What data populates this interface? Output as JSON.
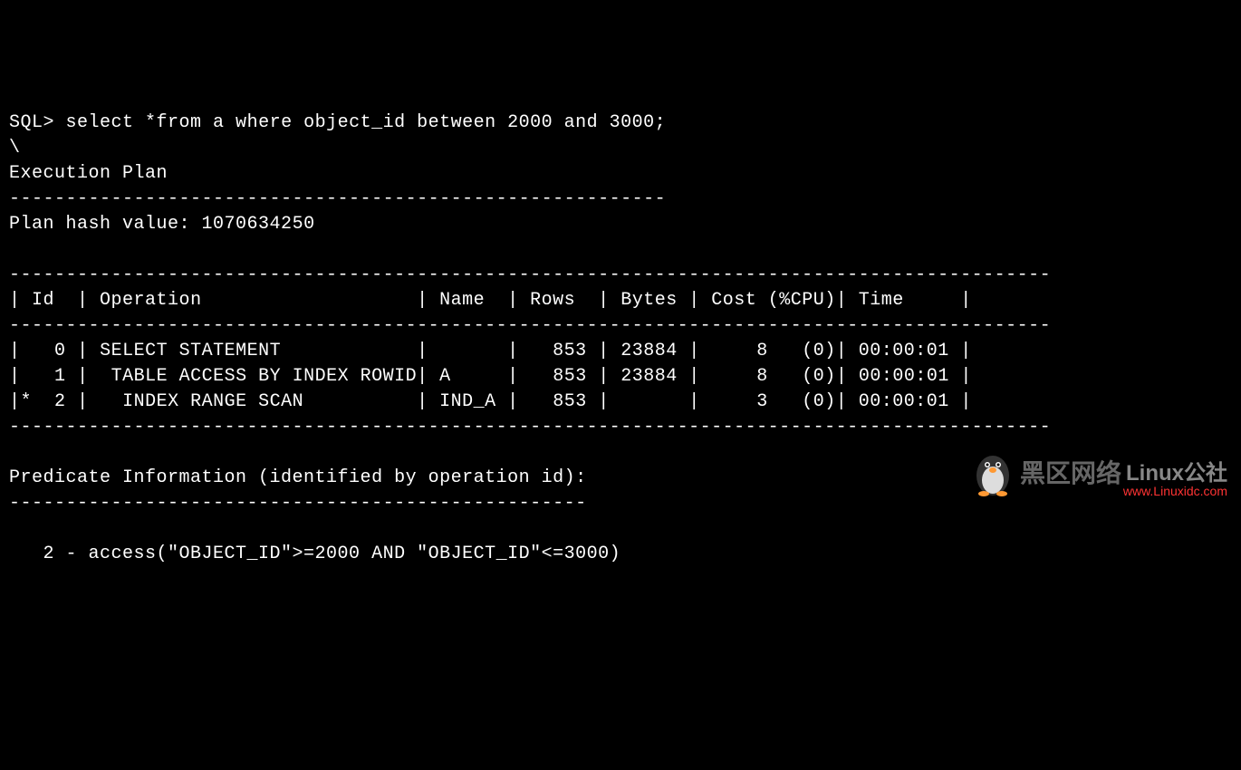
{
  "prompt": "SQL>",
  "query": "select *from a where object_id between 2000 and 3000;",
  "continuation": "\\",
  "section_execution": "Execution Plan",
  "divider_short": "----------------------------------------------------------",
  "plan_hash_label": "Plan hash value:",
  "plan_hash_value": "1070634250",
  "divider_long": "--------------------------------------------------------------------------------------------",
  "table_header": {
    "id": "Id",
    "operation": "Operation",
    "name": "Name",
    "rows": "Rows",
    "bytes": "Bytes",
    "cost": "Cost (%CPU)",
    "time": "Time"
  },
  "plan_rows": [
    {
      "marker": " ",
      "id": "0",
      "operation": "SELECT STATEMENT",
      "name": "",
      "rows": "853",
      "bytes": "23884",
      "cost": "8",
      "cpu": "(0)",
      "time": "00:00:01"
    },
    {
      "marker": " ",
      "id": "1",
      "operation": " TABLE ACCESS BY INDEX ROWID",
      "name": "A",
      "rows": "853",
      "bytes": "23884",
      "cost": "8",
      "cpu": "(0)",
      "time": "00:00:01"
    },
    {
      "marker": "*",
      "id": "2",
      "operation": "  INDEX RANGE SCAN",
      "name": "IND_A",
      "rows": "853",
      "bytes": "",
      "cost": "3",
      "cpu": "(0)",
      "time": "00:00:01"
    }
  ],
  "predicate_header": "Predicate Information (identified by operation id):",
  "predicate_divider": "---------------------------------------------------",
  "predicate_line": "   2 - access(\"OBJECT_ID\">=2000 AND \"OBJECT_ID\"<=3000)",
  "watermark": {
    "cn_text": "黑区网络",
    "linux_text": "Linux公社",
    "url": "www.Linuxidc.com"
  },
  "chart_data": {
    "type": "table",
    "title": "Oracle SQL Execution Plan",
    "columns": [
      "Id",
      "Operation",
      "Name",
      "Rows",
      "Bytes",
      "Cost (%CPU)",
      "Time"
    ],
    "rows": [
      [
        "0",
        "SELECT STATEMENT",
        "",
        853,
        23884,
        "8 (0)",
        "00:00:01"
      ],
      [
        "1",
        "TABLE ACCESS BY INDEX ROWID",
        "A",
        853,
        23884,
        "8 (0)",
        "00:00:01"
      ],
      [
        "* 2",
        "INDEX RANGE SCAN",
        "IND_A",
        853,
        null,
        "3 (0)",
        "00:00:01"
      ]
    ],
    "plan_hash_value": 1070634250,
    "predicates": [
      "2 - access(\"OBJECT_ID\">=2000 AND \"OBJECT_ID\"<=3000)"
    ]
  }
}
